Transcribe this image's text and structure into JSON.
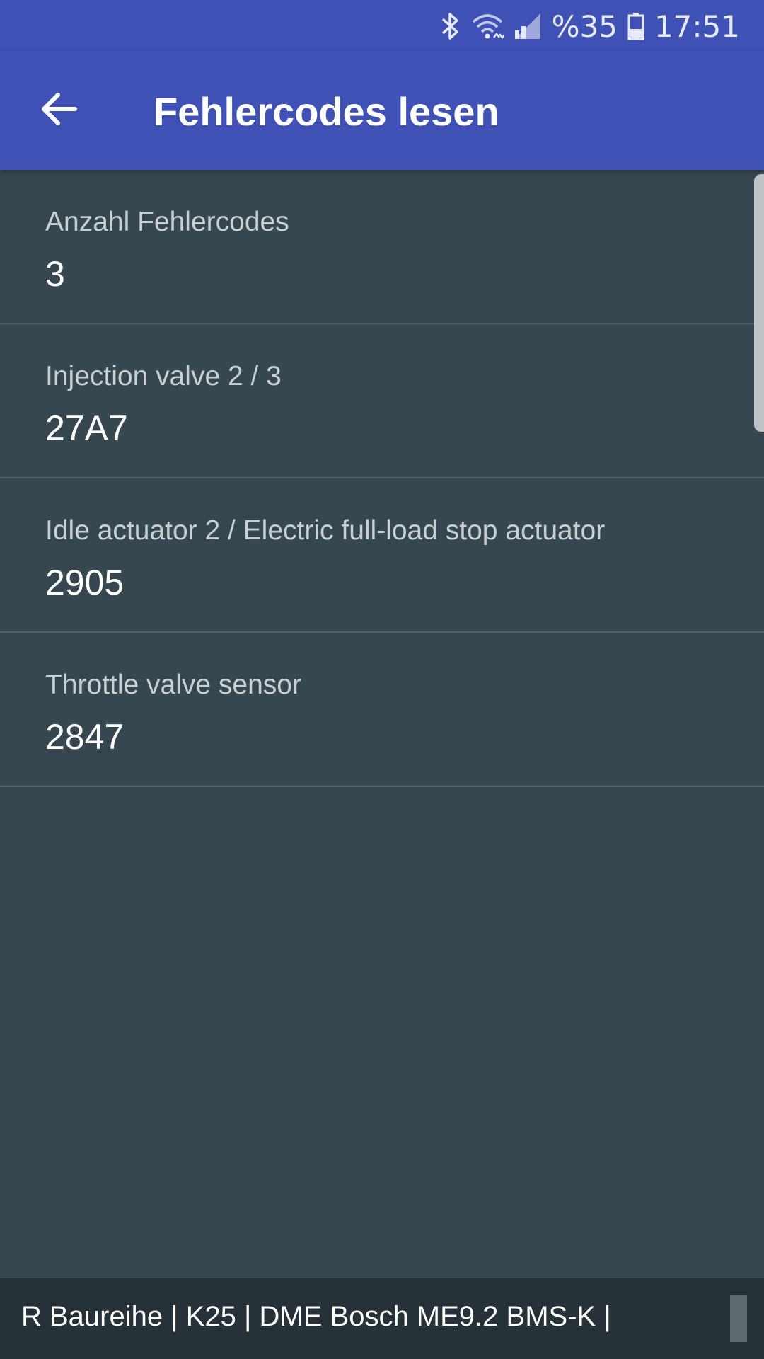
{
  "status_bar": {
    "battery_text": "%35",
    "time": "17:51",
    "icons": [
      "bluetooth-icon",
      "wifi-icon",
      "signal-icon",
      "battery-icon"
    ]
  },
  "app_bar": {
    "title": "Fehlercodes lesen",
    "back_icon": "arrow-left-icon"
  },
  "items": [
    {
      "label": "Anzahl Fehlercodes",
      "value": "3"
    },
    {
      "label": "Injection valve 2 / 3",
      "value": "27A7"
    },
    {
      "label": "Idle actuator 2 / Electric full-load stop actuator",
      "value": "2905"
    },
    {
      "label": "Throttle valve sensor",
      "value": "2847"
    }
  ],
  "footer": {
    "text": "R Baureihe | K25 | DME Bosch ME9.2 BMS-K |"
  },
  "colors": {
    "primary": "#3f51b5",
    "background": "#37474f",
    "footer": "#263238"
  }
}
